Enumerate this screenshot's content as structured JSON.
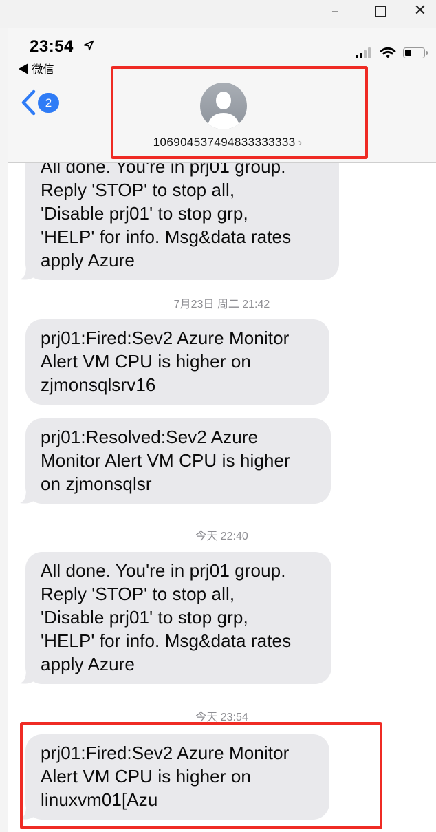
{
  "window": {
    "minimize": "–",
    "close": "✕"
  },
  "status_bar": {
    "time": "23:54",
    "back_app": "◀ 微信"
  },
  "nav": {
    "badge_count": "2"
  },
  "contact": {
    "number": "106904537494833333333",
    "chevron": "›"
  },
  "colors": {
    "accent": "#2f7cf6",
    "bubble": "#e9e9ec",
    "highlight": "#ef2b24",
    "timestamp": "#8e8e93"
  },
  "messages": [
    {
      "type": "bubble",
      "text": "All done. You're in prj01 group.\nReply 'STOP' to stop all,\n'Disable prj01' to stop grp,\n'HELP' for info. Msg&data rates\napply Azure"
    },
    {
      "type": "timestamp",
      "text": "7月23日 周二 21:42"
    },
    {
      "type": "bubble",
      "text": "prj01:Fired:Sev2 Azure Monitor\nAlert VM CPU is higher on\nzjmonsqlsrv16"
    },
    {
      "type": "bubble",
      "text": "prj01:Resolved:Sev2 Azure\nMonitor Alert VM CPU is higher\non zjmonsqlsr"
    },
    {
      "type": "timestamp",
      "text": "今天 22:40"
    },
    {
      "type": "bubble",
      "text": "All done. You're in prj01 group.\nReply 'STOP' to stop all,\n'Disable prj01' to stop grp,\n'HELP' for info. Msg&data rates\napply Azure"
    },
    {
      "type": "timestamp",
      "text": "今天 23:54"
    },
    {
      "type": "bubble",
      "text": "prj01:Fired:Sev2 Azure Monitor\nAlert VM CPU is higher on\nlinuxvm01[Azu"
    }
  ]
}
